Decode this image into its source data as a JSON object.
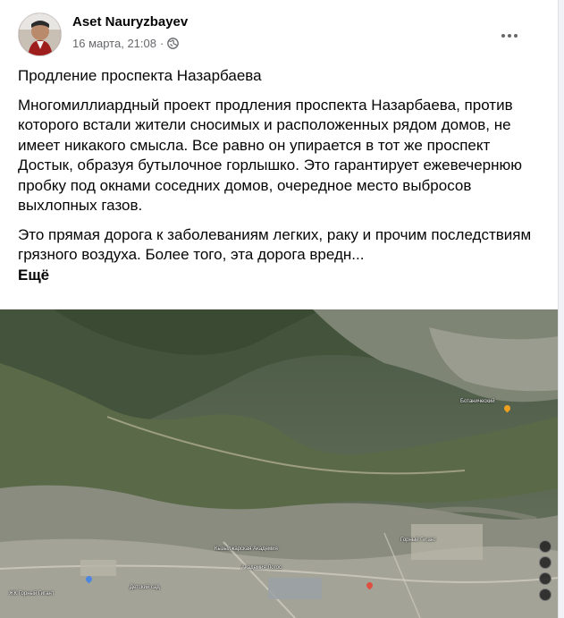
{
  "post": {
    "author": "Aset Nauryzbayev",
    "timestamp": "16 марта, 21:08",
    "separator": "·",
    "title": "Продление проспекта Назарбаева",
    "paragraphs": [
      "Многомиллиардный проект продления проспекта Назарбаева, против которого встали жители сносимых и расположенных рядом домов, не имеет никакого смысла. Все равно он упирается в тот же проспект Достык, образуя бутылочное горлышко. Это гарантирует ежевечернюю пробку под окнами соседних домов, очередное место выбросов выхлопных газов.",
      "Это прямая дорога к заболеваниям легких, раку и прочим последствиям грязного воздуха. Более того, эта дорога вредн..."
    ],
    "see_more": "Ещё"
  },
  "photo": {
    "labels": [
      "Горный Гигант",
      "Кызылжарская Академия",
      "Ботанический",
      "ЖК Горный Гигант",
      "Детский сад",
      "Академия Логос"
    ]
  },
  "icons": {
    "privacy": "globe-icon",
    "options": "more-options-icon"
  },
  "colors": {
    "name": "#050505",
    "meta": "#65676b",
    "background": "#f0f2f5"
  }
}
